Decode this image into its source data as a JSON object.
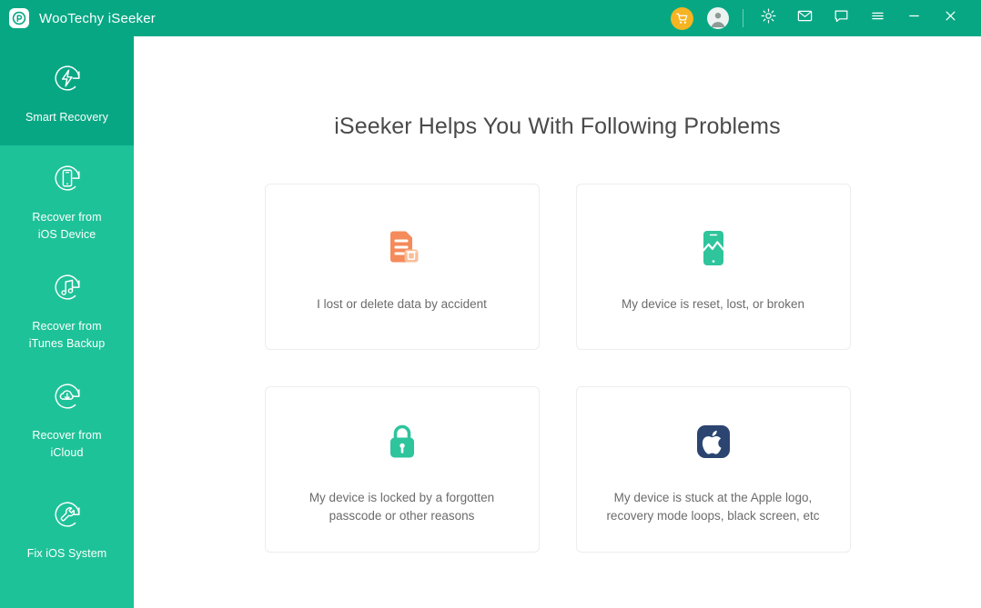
{
  "titlebar": {
    "app_title": "WooTechy iSeeker",
    "logo_icon": "wootechy-logo-icon",
    "accent_teal": "#08a784",
    "cart_color": "#f5b422",
    "actions": [
      {
        "name": "cart-button",
        "icon": "shopping-cart-icon"
      },
      {
        "name": "account-button",
        "icon": "user-avatar-icon"
      },
      {
        "name": "settings-button",
        "icon": "gear-icon"
      },
      {
        "name": "mail-button",
        "icon": "envelope-icon"
      },
      {
        "name": "feedback-button",
        "icon": "speech-bubble-icon"
      },
      {
        "name": "menu-button",
        "icon": "hamburger-menu-icon"
      },
      {
        "name": "minimize-button",
        "icon": "minimize-icon"
      },
      {
        "name": "close-button",
        "icon": "close-icon"
      }
    ]
  },
  "sidebar": {
    "background": "#1ec298",
    "active_background": "#08a784",
    "items": [
      {
        "label": "Smart Recovery",
        "icon": "smart-recovery-icon",
        "active": true
      },
      {
        "label": "Recover from\niOS Device",
        "icon": "ios-device-icon",
        "active": false
      },
      {
        "label": "Recover from\niTunes Backup",
        "icon": "itunes-backup-icon",
        "active": false
      },
      {
        "label": "Recover from\niCloud",
        "icon": "icloud-download-icon",
        "active": false
      },
      {
        "label": "Fix iOS System",
        "icon": "wrench-repair-icon",
        "active": false
      }
    ]
  },
  "main": {
    "title": "iSeeker Helps You With Following Problems",
    "cards": [
      {
        "label": "I lost or delete data by accident",
        "icon": "deleted-document-icon",
        "icon_color": "#f58a5b"
      },
      {
        "label": "My device is reset, lost, or broken",
        "icon": "broken-phone-icon",
        "icon_color": "#2ec49c"
      },
      {
        "label": "My device is locked by a forgotten\npasscode or other reasons",
        "icon": "padlock-icon",
        "icon_color": "#2ec49c"
      },
      {
        "label": "My device is stuck at the Apple logo,\nrecovery mode loops, black screen, etc",
        "icon": "apple-logo-icon",
        "icon_color": "#2b4570"
      }
    ]
  }
}
